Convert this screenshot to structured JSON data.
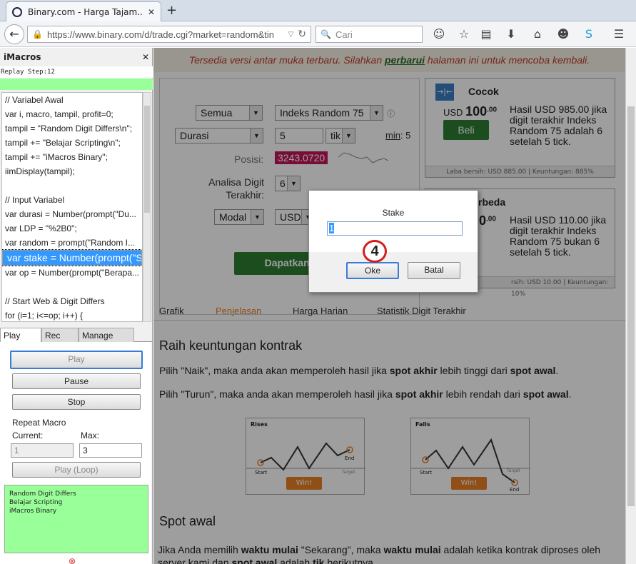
{
  "browser": {
    "tab_title": "Binary.com - Harga Tajam...",
    "url": "https://www.binary.com/d/trade.cgi?market=random&tin",
    "search_placeholder": "Cari"
  },
  "imacros": {
    "title": "iMacros",
    "replay_step": "Replay Step:12",
    "code_lines": [
      "// Variabel Awal",
      "var i, macro, tampil, profit=0;",
      "tampil = \"Random Digit Differs\\n\";",
      "tampil += \"Belajar Scripting\\n\";",
      "tampil += \"iMacros Binary\";",
      "iimDisplay(tampil);",
      "",
      "// Input Variabel",
      "var durasi = Number(prompt(\"Du...",
      "var LDP = \"%2B0\";",
      "var random = prompt(\"Random I...",
      "var stake = Number(prompt(\"Stak...",
      "var op = Number(prompt(\"Berapa...",
      "",
      "// Start Web & Digit Differs",
      "for (i=1; i<=op; i++) {"
    ],
    "tabs": [
      "Play",
      "Rec",
      "Manage"
    ],
    "buttons": {
      "play": "Play",
      "pause": "Pause",
      "stop": "Stop",
      "play_loop": "Play (Loop)"
    },
    "repeat": {
      "label": "Repeat Macro",
      "current_label": "Current:",
      "current_value": "1",
      "max_label": "Max:",
      "max_value": "3"
    },
    "output_lines": [
      "Random Digit Differs",
      "Belajar Scripting",
      "iMacros Binary"
    ]
  },
  "page": {
    "banner_pre": "Tersedia versi antar muka terbaru. Silahkan ",
    "banner_link": "perbarui",
    "banner_post": " halaman ini untuk mencoba kembali.",
    "form": {
      "market": "Semua",
      "underlying": "Indeks Random 75",
      "duration_type": "Durasi",
      "duration_value": "5",
      "duration_unit": "tik",
      "min_label": "min",
      "min_value": ": 5",
      "spot_label": "Posisi:",
      "spot_value": "3243.0720",
      "ldp_label_1": "Analisa Digit",
      "ldp_label_2": "Terakhir:",
      "ldp_value": "6",
      "amount_type": "Modal",
      "currency": "USD",
      "get_price": "Dapatkan Ha"
    },
    "card1": {
      "title": "Cocok",
      "currency": "USD",
      "amount": "100",
      "cents": ".00",
      "buy": "Beli",
      "desc": [
        "Hasil USD 985.00 jika",
        "digit terakhir Indeks",
        "Random 75 adalah 6",
        "setelah 5 tick."
      ],
      "footer": "Laba bersih: USD 885.00 | Keuntungan: 885%"
    },
    "card2": {
      "title": "rbeda",
      "amount": "0",
      "cents": ".00",
      "desc": [
        "Hasil USD 110.00 jika",
        "digit terakhir Indeks",
        "Random 75 bukan 6",
        "setelah 5 tick."
      ],
      "footer": "rsih: USD 10.00 | Keuntungan: 10%"
    },
    "content_tabs": [
      "Grafik",
      "Penjelasan",
      "Harga Harian",
      "Statistik Digit Terakhir"
    ],
    "heading1": "Raih keuntungan kontrak",
    "para1": {
      "a": "Pilih \"Naik\", maka anda akan memperoleh hasil jika ",
      "b": "spot akhir",
      "c": " lebih tinggi dari ",
      "d": "spot awal",
      "e": "."
    },
    "para2": {
      "a": "Pilih \"Turun\", maka anda akan memperoleh hasil jika ",
      "b": "spot akhir",
      "c": " lebih rendah dari ",
      "d": "spot awal",
      "e": "."
    },
    "chart_rises": {
      "title": "Rises",
      "start": "Start",
      "end": "End",
      "target": "Target",
      "win": "Win!"
    },
    "chart_falls": {
      "title": "Falls",
      "start": "Start",
      "end": "End",
      "target": "Target",
      "win": "Win!"
    },
    "heading2": "Spot awal",
    "para3": {
      "a": "Jika Anda memilih ",
      "b": "waktu mulai",
      "c": " \"Sekarang\", maka ",
      "d": "waktu mulai",
      "e": " adalah ketika kontrak diproses oleh"
    },
    "para4": {
      "a": "server kami dan ",
      "b": "spot awal",
      "c": " adalah ",
      "d": "tik",
      "e": " berikutnya."
    }
  },
  "dialog": {
    "label": "Stake",
    "value": "1",
    "ok": "Oke",
    "cancel": "Batal"
  },
  "step_marker": "4"
}
